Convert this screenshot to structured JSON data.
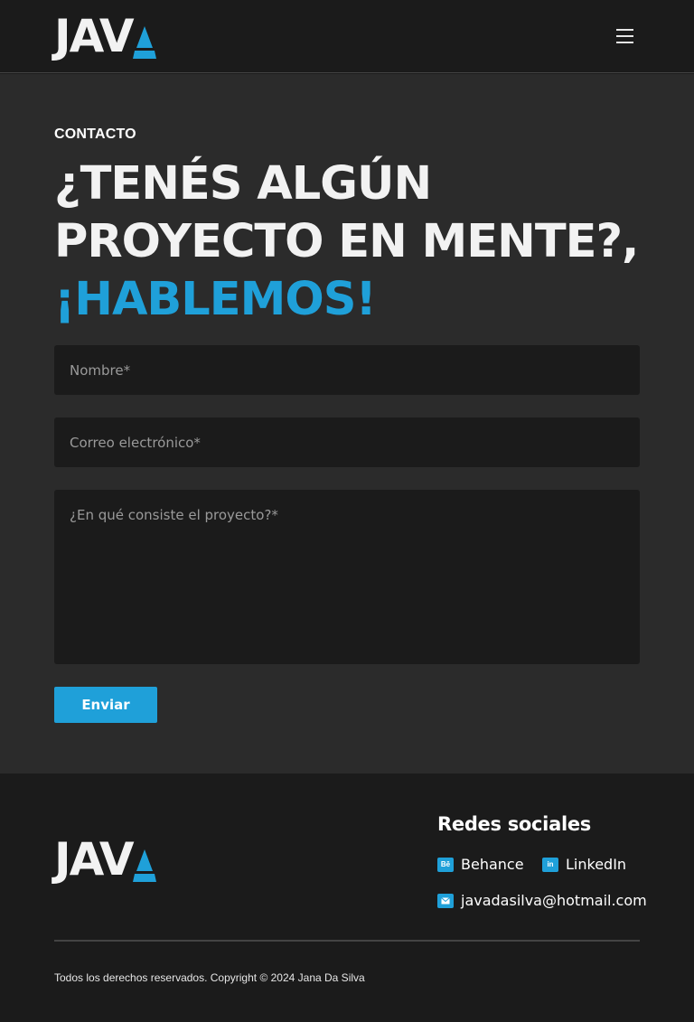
{
  "brand": {
    "logo_text": "JAV",
    "accent_color": "#1fa0d9"
  },
  "header": {
    "menu_icon": "hamburger-menu-icon"
  },
  "contact": {
    "eyebrow": "CONTACTO",
    "headline_line1": "¿TENÉS ALGÚN",
    "headline_line2": "PROYECTO EN MENTE?,",
    "headline_accent": "¡HABLEMOS!",
    "form": {
      "name_placeholder": "Nombre*",
      "email_placeholder": "Correo electrónico*",
      "message_placeholder": "¿En qué consiste el proyecto?*",
      "submit_label": "Enviar"
    }
  },
  "footer": {
    "social_title": "Redes sociales",
    "links": [
      {
        "label": "Behance",
        "icon": "behance-icon",
        "icon_text": "Bē"
      },
      {
        "label": "LinkedIn",
        "icon": "linkedin-icon",
        "icon_text": "in"
      },
      {
        "label": "javadasilva@hotmail.com",
        "icon": "mail-icon"
      }
    ],
    "copyright": "Todos los derechos reservados. Copyright © 2024 Jana Da Silva"
  }
}
